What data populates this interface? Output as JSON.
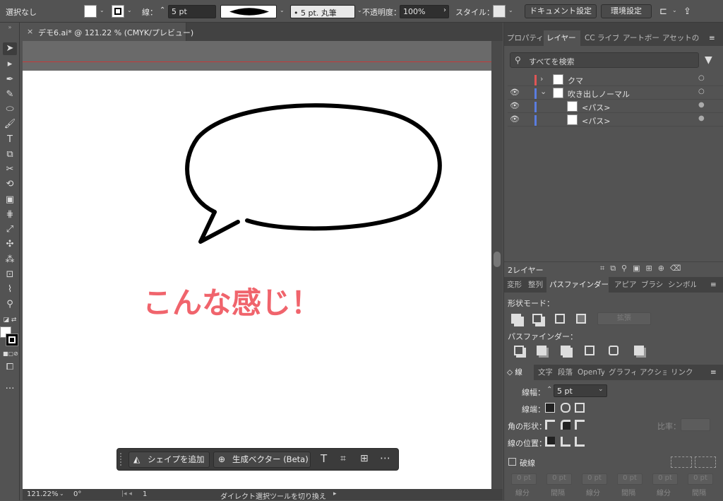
{
  "control_bar": {
    "selection": "選択なし",
    "stroke_label": "線：",
    "stroke_weight": "5 pt",
    "brush": "5 pt. 丸筆",
    "opacity_label": "不透明度：",
    "opacity_value": "100%",
    "style_label": "スタイル：",
    "doc_settings": "ドキュメント設定",
    "preferences": "環境設定"
  },
  "document": {
    "tab_title": "デモ6.ai* @ 121.22 % (CMYK/プレビュー)",
    "close": "×",
    "caption": "こんな感じ！",
    "caption_color": "#f0646c"
  },
  "status_bar": {
    "zoom": "121.22%",
    "rotation": "0°",
    "artboard": "1",
    "hint": "ダイレクト選択ツールを切り換え"
  },
  "task_bar": {
    "add_shape": "シェイプを追加",
    "gen_vector": "生成ベクター (Beta)"
  },
  "panels": {
    "top_tabs": [
      "プロパティ",
      "レイヤー",
      "CC ライブ",
      "アートボー",
      "アセットの"
    ],
    "search_placeholder": "すべてを検索",
    "layers": [
      {
        "name": "クマ",
        "color": "#e05656"
      },
      {
        "name": "吹き出しノーマル",
        "color": "#5a7de0"
      },
      {
        "name": "<パス>",
        "color": "#5a7de0"
      },
      {
        "name": "<パス>",
        "color": "#5a7de0"
      }
    ],
    "layer_count": "2レイヤー",
    "mid_tabs": [
      "変形",
      "整列",
      "パスファインダー",
      "アピア",
      "ブラシ",
      "シンボル"
    ],
    "shape_modes_label": "形状モード：",
    "expand": "拡張",
    "pathfinder_label": "パスファインダー：",
    "bottom_tabs": [
      "線",
      "文字",
      "段落",
      "OpenTy",
      "グラフィ",
      "アクショ",
      "リンク"
    ],
    "stroke": {
      "weight_label": "線幅：",
      "weight_value": "5 pt",
      "cap_label": "線端：",
      "corner_label": "角の形状：",
      "ratio_label": "比率：",
      "align_label": "線の位置：",
      "dashed_label": "破線",
      "dash_labels": [
        "線分",
        "間隔",
        "線分",
        "間隔",
        "線分",
        "間隔"
      ],
      "dash_values": [
        "0 pt",
        "0 pt",
        "0 pt",
        "0 pt",
        "0 pt",
        "0 pt"
      ]
    }
  }
}
